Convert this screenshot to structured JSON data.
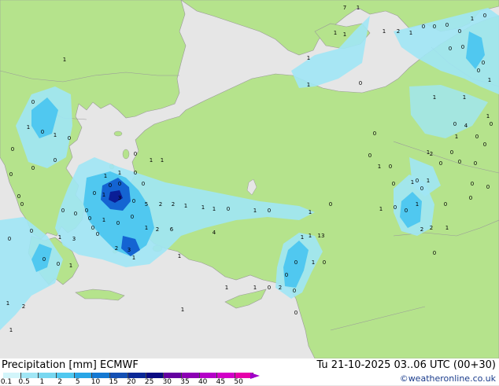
{
  "map": {
    "model": "ECMWF",
    "colors": {
      "sea": "#e6e6e6",
      "land": "#b5e38c",
      "border": "#999999",
      "rain_light": "#a0e6f5",
      "rain_med": "#50c8f0",
      "rain_heavy": "#1464d2",
      "rain_max": "#0a1e96"
    },
    "values": [
      "7",
      "1",
      "1",
      "0",
      "1",
      "1",
      "1",
      "1",
      "1",
      "2",
      "1",
      "0",
      "0",
      "0",
      "0",
      "0",
      "0",
      "0",
      "0",
      "1",
      "1",
      "0",
      "0",
      "1",
      "0",
      "1",
      "0",
      "0",
      "0",
      "1",
      "1",
      "1",
      "0",
      "0",
      "0",
      "0",
      "0",
      "0",
      "0",
      "0",
      "0",
      "0",
      "1",
      "1",
      "1",
      "0",
      "0",
      "0",
      "0",
      "0",
      "3",
      "0",
      "5",
      "2",
      "2",
      "1",
      "1",
      "1",
      "0",
      "1",
      "0",
      "1",
      "1",
      "0",
      "0",
      "1",
      "1",
      "0",
      "2",
      "4",
      "0",
      "0",
      "1",
      "0",
      "0",
      "1",
      "2",
      "6",
      "4",
      "1",
      "3",
      "1",
      "0",
      "0",
      "1",
      "2",
      "3",
      "1",
      "1",
      "1",
      "13",
      "0",
      "1",
      "0",
      "0",
      "0",
      "0",
      "2",
      "0",
      "1",
      "1",
      "1",
      "2",
      "1",
      "1",
      "2",
      "2",
      "1",
      "0",
      "0",
      "1",
      "0",
      "1",
      "0",
      "0",
      "0",
      "0",
      "0",
      "0",
      "0",
      "1",
      "1",
      "1",
      "0",
      "0",
      "0",
      "0",
      "0",
      "0",
      "1",
      "0",
      "0",
      "0",
      "0"
    ]
  },
  "footer": {
    "legend_title": "Precipitation [mm]  ECMWF",
    "valid_time": "Tu 21-10-2025 03..06 UTC (00+30)",
    "credit": "©weatheronline.co.uk",
    "scale_labels": [
      "0.1",
      "0.5",
      "1",
      "2",
      "5",
      "10",
      "15",
      "20",
      "25",
      "30",
      "35",
      "40",
      "45",
      "50"
    ],
    "scale_colors": [
      "#d2f5fa",
      "#a0e6f5",
      "#78d7f0",
      "#50c8f0",
      "#28a5e6",
      "#1478d2",
      "#1450b4",
      "#0a2896",
      "#0a0a82",
      "#6400a0",
      "#8c00b4",
      "#b400c8",
      "#d200c8",
      "#e600aa"
    ]
  }
}
